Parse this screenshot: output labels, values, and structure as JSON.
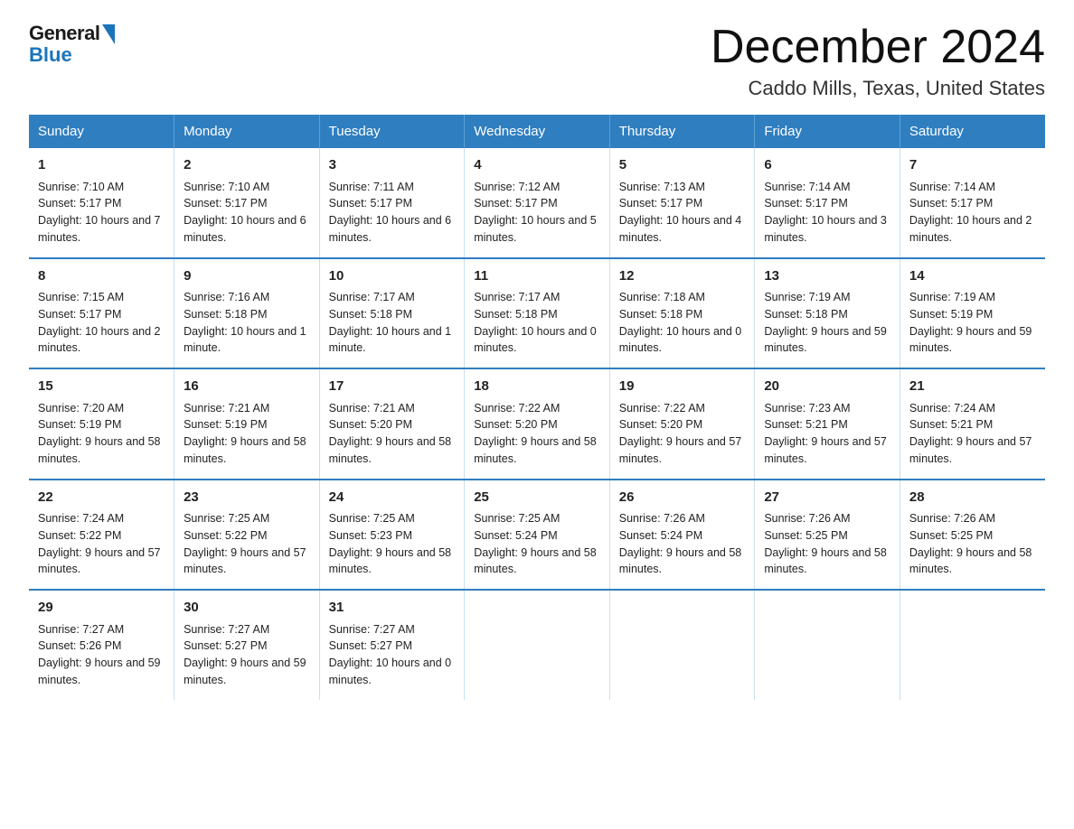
{
  "header": {
    "logo_general": "General",
    "logo_blue": "Blue",
    "month_title": "December 2024",
    "location": "Caddo Mills, Texas, United States"
  },
  "weekdays": [
    "Sunday",
    "Monday",
    "Tuesday",
    "Wednesday",
    "Thursday",
    "Friday",
    "Saturday"
  ],
  "weeks": [
    [
      {
        "day": "1",
        "sunrise": "7:10 AM",
        "sunset": "5:17 PM",
        "daylight": "10 hours and 7 minutes."
      },
      {
        "day": "2",
        "sunrise": "7:10 AM",
        "sunset": "5:17 PM",
        "daylight": "10 hours and 6 minutes."
      },
      {
        "day": "3",
        "sunrise": "7:11 AM",
        "sunset": "5:17 PM",
        "daylight": "10 hours and 6 minutes."
      },
      {
        "day": "4",
        "sunrise": "7:12 AM",
        "sunset": "5:17 PM",
        "daylight": "10 hours and 5 minutes."
      },
      {
        "day": "5",
        "sunrise": "7:13 AM",
        "sunset": "5:17 PM",
        "daylight": "10 hours and 4 minutes."
      },
      {
        "day": "6",
        "sunrise": "7:14 AM",
        "sunset": "5:17 PM",
        "daylight": "10 hours and 3 minutes."
      },
      {
        "day": "7",
        "sunrise": "7:14 AM",
        "sunset": "5:17 PM",
        "daylight": "10 hours and 2 minutes."
      }
    ],
    [
      {
        "day": "8",
        "sunrise": "7:15 AM",
        "sunset": "5:17 PM",
        "daylight": "10 hours and 2 minutes."
      },
      {
        "day": "9",
        "sunrise": "7:16 AM",
        "sunset": "5:18 PM",
        "daylight": "10 hours and 1 minute."
      },
      {
        "day": "10",
        "sunrise": "7:17 AM",
        "sunset": "5:18 PM",
        "daylight": "10 hours and 1 minute."
      },
      {
        "day": "11",
        "sunrise": "7:17 AM",
        "sunset": "5:18 PM",
        "daylight": "10 hours and 0 minutes."
      },
      {
        "day": "12",
        "sunrise": "7:18 AM",
        "sunset": "5:18 PM",
        "daylight": "10 hours and 0 minutes."
      },
      {
        "day": "13",
        "sunrise": "7:19 AM",
        "sunset": "5:18 PM",
        "daylight": "9 hours and 59 minutes."
      },
      {
        "day": "14",
        "sunrise": "7:19 AM",
        "sunset": "5:19 PM",
        "daylight": "9 hours and 59 minutes."
      }
    ],
    [
      {
        "day": "15",
        "sunrise": "7:20 AM",
        "sunset": "5:19 PM",
        "daylight": "9 hours and 58 minutes."
      },
      {
        "day": "16",
        "sunrise": "7:21 AM",
        "sunset": "5:19 PM",
        "daylight": "9 hours and 58 minutes."
      },
      {
        "day": "17",
        "sunrise": "7:21 AM",
        "sunset": "5:20 PM",
        "daylight": "9 hours and 58 minutes."
      },
      {
        "day": "18",
        "sunrise": "7:22 AM",
        "sunset": "5:20 PM",
        "daylight": "9 hours and 58 minutes."
      },
      {
        "day": "19",
        "sunrise": "7:22 AM",
        "sunset": "5:20 PM",
        "daylight": "9 hours and 57 minutes."
      },
      {
        "day": "20",
        "sunrise": "7:23 AM",
        "sunset": "5:21 PM",
        "daylight": "9 hours and 57 minutes."
      },
      {
        "day": "21",
        "sunrise": "7:24 AM",
        "sunset": "5:21 PM",
        "daylight": "9 hours and 57 minutes."
      }
    ],
    [
      {
        "day": "22",
        "sunrise": "7:24 AM",
        "sunset": "5:22 PM",
        "daylight": "9 hours and 57 minutes."
      },
      {
        "day": "23",
        "sunrise": "7:25 AM",
        "sunset": "5:22 PM",
        "daylight": "9 hours and 57 minutes."
      },
      {
        "day": "24",
        "sunrise": "7:25 AM",
        "sunset": "5:23 PM",
        "daylight": "9 hours and 58 minutes."
      },
      {
        "day": "25",
        "sunrise": "7:25 AM",
        "sunset": "5:24 PM",
        "daylight": "9 hours and 58 minutes."
      },
      {
        "day": "26",
        "sunrise": "7:26 AM",
        "sunset": "5:24 PM",
        "daylight": "9 hours and 58 minutes."
      },
      {
        "day": "27",
        "sunrise": "7:26 AM",
        "sunset": "5:25 PM",
        "daylight": "9 hours and 58 minutes."
      },
      {
        "day": "28",
        "sunrise": "7:26 AM",
        "sunset": "5:25 PM",
        "daylight": "9 hours and 58 minutes."
      }
    ],
    [
      {
        "day": "29",
        "sunrise": "7:27 AM",
        "sunset": "5:26 PM",
        "daylight": "9 hours and 59 minutes."
      },
      {
        "day": "30",
        "sunrise": "7:27 AM",
        "sunset": "5:27 PM",
        "daylight": "9 hours and 59 minutes."
      },
      {
        "day": "31",
        "sunrise": "7:27 AM",
        "sunset": "5:27 PM",
        "daylight": "10 hours and 0 minutes."
      },
      {
        "day": "",
        "sunrise": "",
        "sunset": "",
        "daylight": ""
      },
      {
        "day": "",
        "sunrise": "",
        "sunset": "",
        "daylight": ""
      },
      {
        "day": "",
        "sunrise": "",
        "sunset": "",
        "daylight": ""
      },
      {
        "day": "",
        "sunrise": "",
        "sunset": "",
        "daylight": ""
      }
    ]
  ],
  "labels": {
    "sunrise_prefix": "Sunrise: ",
    "sunset_prefix": "Sunset: ",
    "daylight_prefix": "Daylight: "
  }
}
